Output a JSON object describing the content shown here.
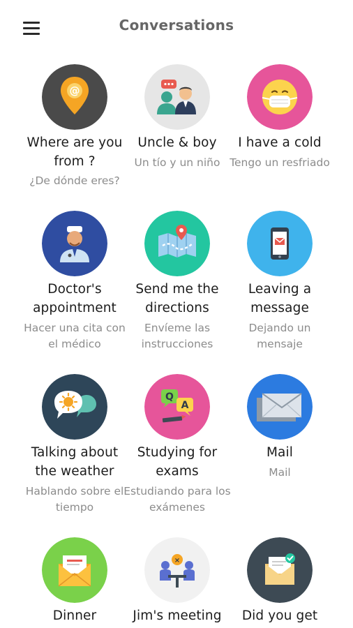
{
  "app_bar": {
    "title": "Conversations",
    "menu_icon": "hamburger-menu-icon"
  },
  "colors": {
    "title": "#666666",
    "subtitle": "#8c8c8c",
    "circle_dark": "#4a4a4a",
    "circle_light_grey": "#e6e6e6",
    "circle_pink": "#e6559a",
    "circle_navy": "#2f4da1",
    "circle_teal": "#23c6a0",
    "circle_sky": "#3fb3ec",
    "circle_slate": "#2e4659",
    "circle_blue": "#2c7be0",
    "circle_green": "#7ad14a",
    "circle_pale": "#f1f1f1",
    "circle_charcoal": "#3d4a54"
  },
  "conversations": [
    {
      "title": "Where are you from ?",
      "subtitle": "¿De dónde eres?",
      "icon": "location-pin-icon"
    },
    {
      "title": "Uncle & boy",
      "subtitle": "Un tío y un niño",
      "icon": "people-chat-icon"
    },
    {
      "title": "I have a cold",
      "subtitle": "Tengo un resfriado",
      "icon": "face-mask-icon"
    },
    {
      "title": "Doctor's appointment",
      "subtitle": "Hacer una cita con el médico",
      "icon": "doctor-icon"
    },
    {
      "title": "Send me the directions",
      "subtitle": "Envíeme las instrucciones",
      "icon": "map-icon"
    },
    {
      "title": "Leaving a message",
      "subtitle": "Dejando un mensaje",
      "icon": "phone-message-icon"
    },
    {
      "title": "Talking about the weather",
      "subtitle": "Hablando sobre el tiempo",
      "icon": "weather-bubble-icon"
    },
    {
      "title": "Studying for exams",
      "subtitle": "Estudiando para los exámenes",
      "icon": "qa-study-icon"
    },
    {
      "title": "Mail",
      "subtitle": "Mail",
      "icon": "envelope-icon"
    },
    {
      "title": "Dinner",
      "subtitle": "",
      "icon": "invitation-envelope-icon"
    },
    {
      "title": "Jim's meeting",
      "subtitle": "",
      "icon": "meeting-table-icon"
    },
    {
      "title": "Did you get",
      "subtitle": "",
      "icon": "checked-mail-icon"
    }
  ]
}
